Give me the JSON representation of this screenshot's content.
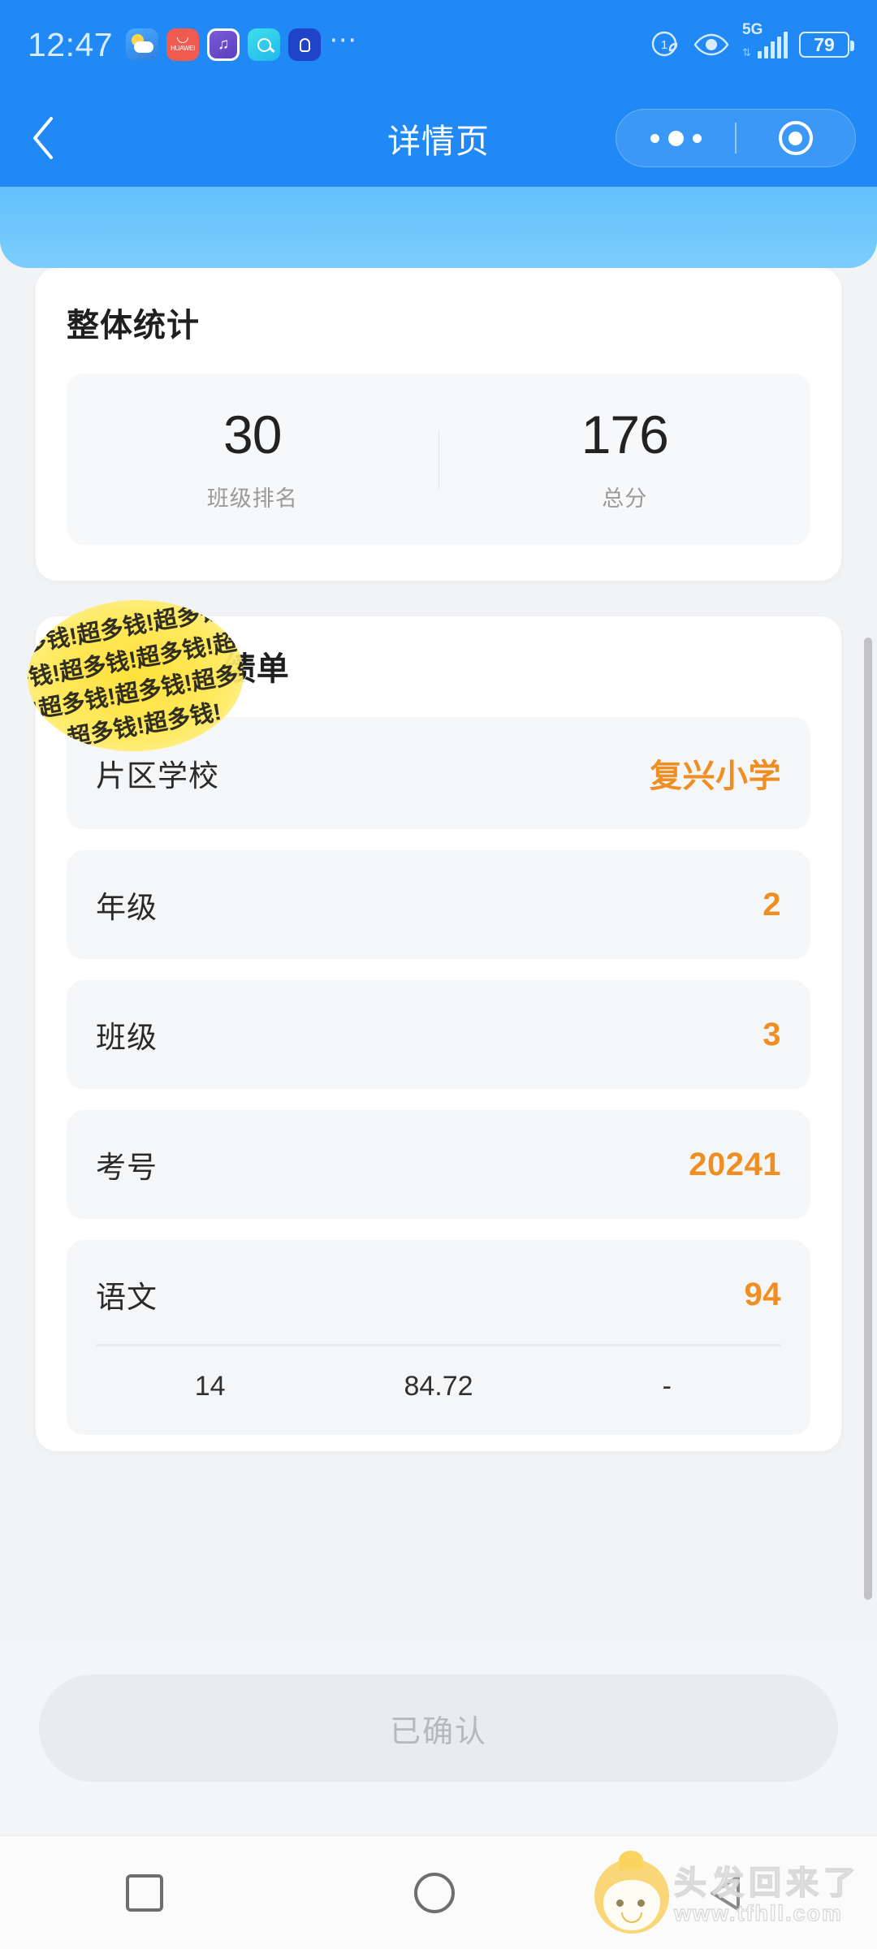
{
  "statusbar": {
    "clock": "12:47",
    "apps": [
      {
        "name": "weather-app-icon",
        "label": ""
      },
      {
        "name": "huawei-app-icon",
        "label": "HUAWEI"
      },
      {
        "name": "music-app-icon",
        "label": "♫"
      },
      {
        "name": "search-app-icon",
        "label": ""
      },
      {
        "name": "bulb-app-icon",
        "label": ""
      }
    ],
    "overflow": "⋯",
    "network_type": "5G",
    "battery_percent": "79"
  },
  "header": {
    "title": "详情页",
    "back_icon": "chevron-left-icon",
    "menu_icon": "more-dots-icon",
    "close_icon": "target-circle-icon"
  },
  "overall": {
    "title": "整体统计",
    "stats": [
      {
        "value": "30",
        "label": "班级排名"
      },
      {
        "value": "176",
        "label": "总分"
      }
    ]
  },
  "report": {
    "title_suffix": "的成绩单",
    "sticker_text": "超多钱!超多钱!超多钱!超多钱!超多钱!超多钱!超多钱!超多钱!超多钱!超多钱!超多钱!超多钱!",
    "rows": [
      {
        "key": "片区学校",
        "value": "复兴小学"
      },
      {
        "key": "年级",
        "value": "2"
      },
      {
        "key": "班级",
        "value": "3"
      },
      {
        "key": "考号",
        "value": "20241"
      }
    ],
    "subject": {
      "key": "语文",
      "value": "94",
      "cells": [
        "14",
        "84.72",
        "-"
      ]
    }
  },
  "footer": {
    "confirm_label": "已确认"
  },
  "androidnav": {
    "recents_icon": "square-recents-icon",
    "home_icon": "circle-home-icon",
    "back_icon": "triangle-back-icon"
  },
  "watermark": {
    "cn": "头发回来了",
    "url": "www.tfhll.com"
  },
  "colors": {
    "header_blue": "#2089f5",
    "banner_blue": "#63c0fb",
    "accent_orange": "#ef8f23",
    "page_bg": "#f2f3f5",
    "card_bg": "#ffffff",
    "row_bg": "#f5f6f8"
  }
}
